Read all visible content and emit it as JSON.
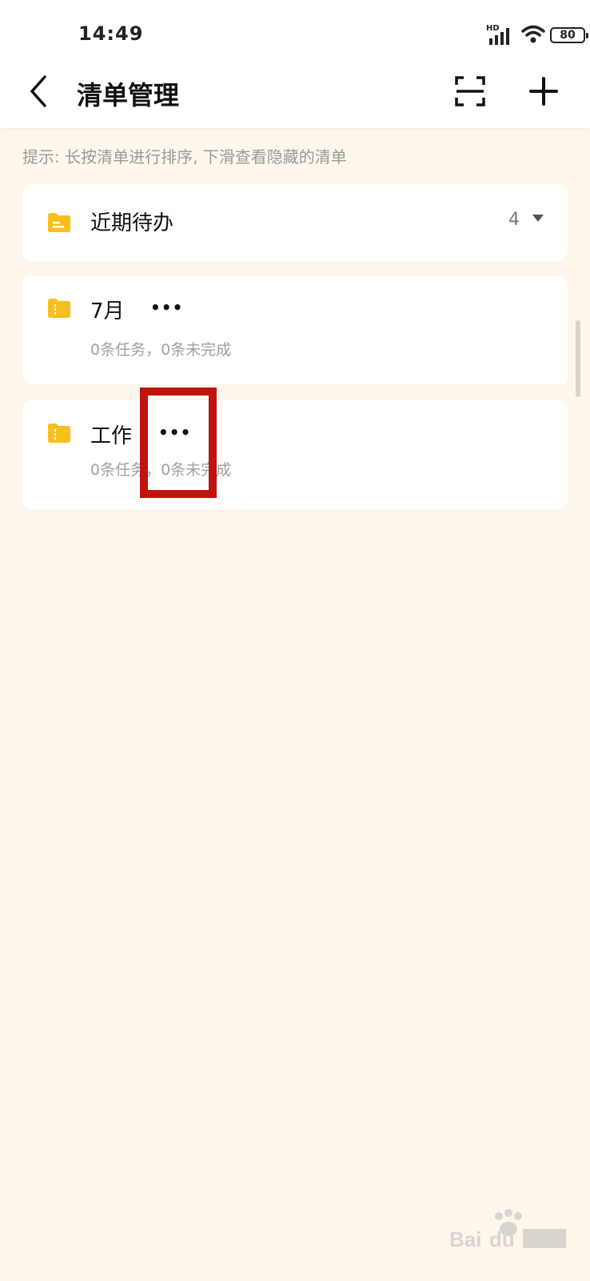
{
  "status_bar": {
    "time": "14:49",
    "network": "HD",
    "battery": "80",
    "icons": [
      "signal-icon",
      "wifi-icon",
      "battery-icon"
    ]
  },
  "header": {
    "title": "清单管理",
    "back_icon": "chevron-left-icon",
    "scan_icon": "scan-icon",
    "add_icon": "plus-icon"
  },
  "hint": "提示: 长按清单进行排序, 下滑查看隐藏的清单",
  "lists": [
    {
      "name": "近期待办",
      "count": "4",
      "icon": "folder-icon",
      "icon_color": "#f7c01f"
    },
    {
      "name": "7月",
      "subtitle": "0条任务，0条未完成",
      "more": "•••",
      "icon": "folder-icon",
      "icon_color": "#f7c01f"
    },
    {
      "name": "工作",
      "subtitle": "0条任务，0条未完成",
      "more": "•••",
      "icon": "folder-icon",
      "icon_color": "#f7c01f"
    }
  ],
  "annotation": {
    "color": "#c0140f"
  },
  "colors": {
    "background": "#fdf6eb",
    "card": "#ffffff",
    "accent": "#f7c01f"
  }
}
